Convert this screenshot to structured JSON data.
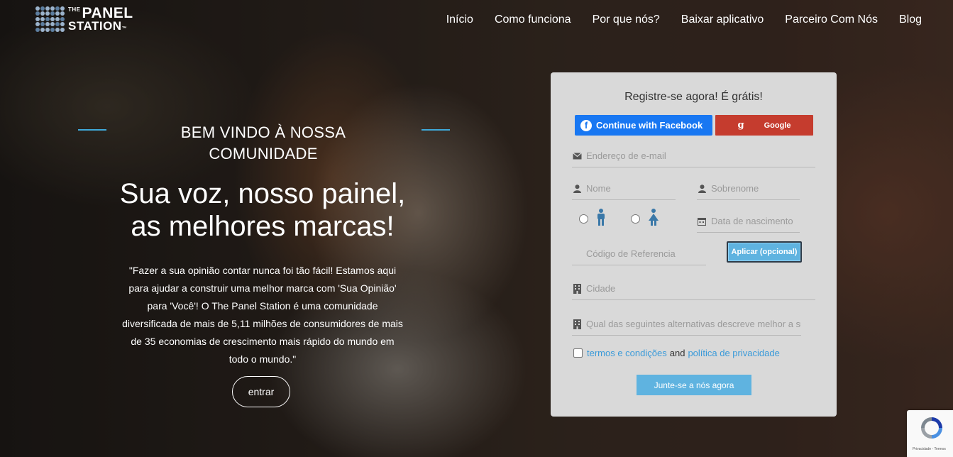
{
  "logo": {
    "the": "THE",
    "line1": "PANEL",
    "line2": "STATION",
    "tm": "™"
  },
  "nav": [
    "Início",
    "Como funciona",
    "Por que nós?",
    "Baixar aplicativo",
    "Parceiro Com Nós",
    "Blog"
  ],
  "hero": {
    "welcome": "BEM VINDO À NOSSA COMUNIDADE",
    "headline_1": "Sua voz, nosso painel,",
    "headline_2": "as melhores marcas!",
    "description": "\"Fazer a sua opinião contar nunca foi tão fácil! Estamos aqui para ajudar a construir uma melhor marca com 'Sua Opinião' para 'Você'! O The Panel Station é uma comunidade diversificada de mais de 5,11 milhões de consumidores de mais de 35 economias de crescimento mais rápido do mundo em todo o mundo.\"",
    "enter_label": "entrar"
  },
  "form": {
    "title": "Registre-se agora! É grátis!",
    "facebook_label": "Continue with Facebook",
    "google_icon": "g",
    "google_label": "Google",
    "email_placeholder": "Endereço de e-mail",
    "first_name_placeholder": "Nome",
    "last_name_placeholder": "Sobrenome",
    "dob_placeholder": "Data de nascimento",
    "referral_placeholder": "Código de Referencia",
    "apply_label": "Aplicar (opcional)",
    "city_placeholder": "Cidade",
    "occupation_placeholder": "Qual das seguintes alternativas descreve melhor a sua situação",
    "terms_link": "termos e condições",
    "and_text": "and",
    "privacy_link": "política de privacidade",
    "join_label": "Junte-se a nós agora"
  },
  "recaptcha": {
    "text": "Privacidade - Termos"
  },
  "colors": {
    "accent": "#3fa9d9",
    "facebook": "#1877f2",
    "google": "#c53c2e",
    "button": "#5fb3e0",
    "card": "#d9d9d9"
  },
  "icons": [
    "envelope-icon",
    "user-icon",
    "calendar-icon",
    "building-icon",
    "male-icon",
    "female-icon",
    "facebook-icon",
    "google-icon",
    "recaptcha-icon"
  ]
}
